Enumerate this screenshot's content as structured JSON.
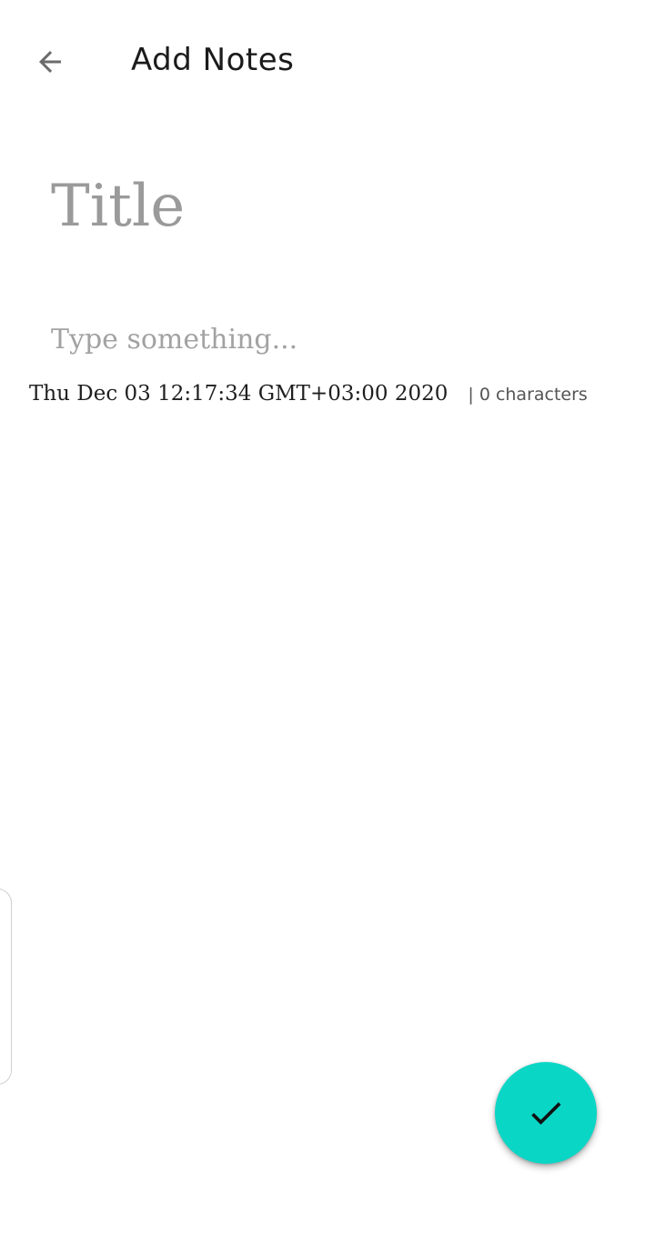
{
  "header": {
    "back_icon": "arrow-left-icon",
    "title": "Add Notes"
  },
  "editor": {
    "title_placeholder": "Title",
    "title_value": "",
    "body_placeholder": "Type something...",
    "body_value": ""
  },
  "meta": {
    "timestamp": "Thu Dec 03 12:17:34 GMT+03:00 2020",
    "char_count": "| 0 characters"
  },
  "fab": {
    "icon": "check-icon",
    "color": "#0ad6c6"
  },
  "colors": {
    "background": "#ffffff",
    "placeholder": "#9a9a9a",
    "accent": "#0ad6c6"
  }
}
